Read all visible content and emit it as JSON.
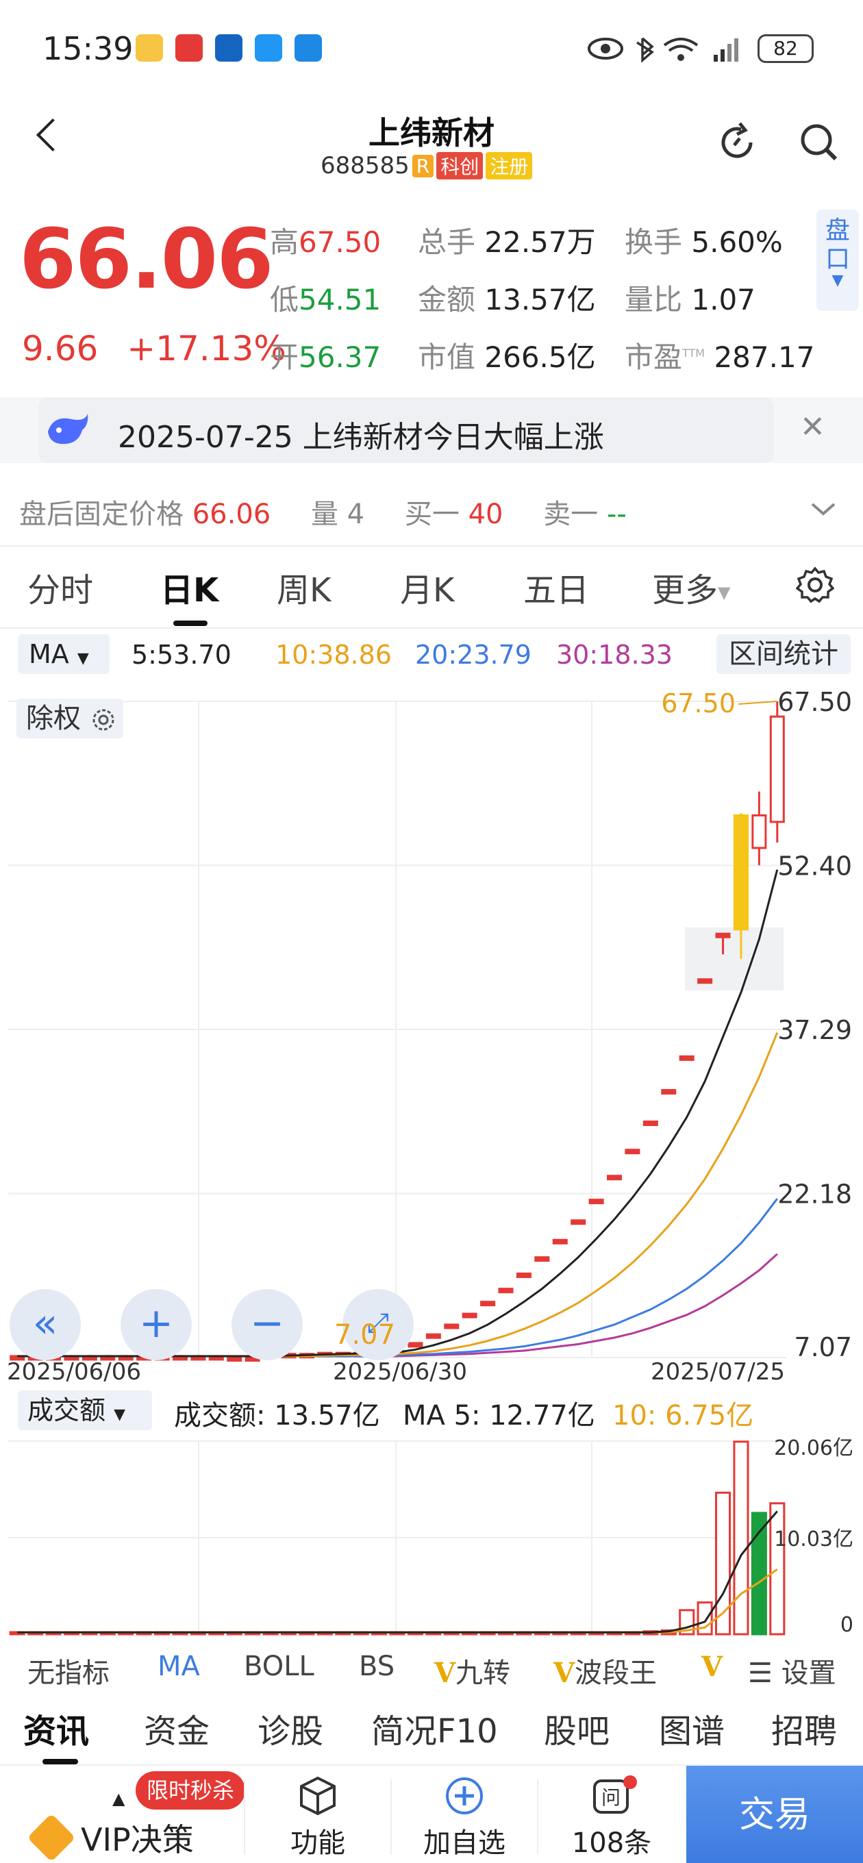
{
  "status_bar": {
    "time": "15:39",
    "battery": "82"
  },
  "header": {
    "title": "上纬新材",
    "code": "688585",
    "tag_r": "R",
    "tag_kechuang": "科创",
    "tag_zhuce": "注册"
  },
  "quote": {
    "price": "66.06",
    "change": "9.66",
    "change_pct": "+17.13%",
    "high_label": "高",
    "high": "67.50",
    "low_label": "低",
    "low": "54.51",
    "open_label": "开",
    "open": "56.37",
    "volume_label": "总手",
    "volume": "22.57万",
    "amount_label": "金额",
    "amount": "13.57亿",
    "mktcap_label": "市值",
    "mktcap": "266.5亿",
    "turnover_label": "换手",
    "turnover": "5.60%",
    "volratio_label": "量比",
    "volratio": "1.07",
    "pe_label": "市盈",
    "pe_sup": "TTM",
    "pe": "287.17",
    "pankou": "盘口"
  },
  "news": {
    "text": "2025-07-25 上纬新材今日大幅上涨"
  },
  "after_hours": {
    "label": "盘后固定价格",
    "price": "66.06",
    "vol_label": "量",
    "vol": "4",
    "buy1_label": "买一",
    "buy1": "40",
    "sell1_label": "卖一",
    "sell1": "--"
  },
  "tabs": [
    "分时",
    "日K",
    "周K",
    "月K",
    "五日",
    "更多"
  ],
  "ma_line": {
    "selector": "MA",
    "ma5": "5:53.70",
    "ma10": "10:38.86",
    "ma20": "20:23.79",
    "ma30": "30:18.33",
    "range_stats": "区间统计"
  },
  "chart_controls": {
    "chuquan": "除权"
  },
  "colors": {
    "up": "#e53935",
    "down": "#1b9e3e",
    "ma5": "#222222",
    "ma10": "#e8a21a",
    "ma20": "#3d7be0",
    "ma30": "#b43b9a",
    "accent": "#3d7be0"
  },
  "chart_data": [
    {
      "type": "candlestick",
      "y_ticks": [
        "67.50",
        "52.40",
        "37.29",
        "22.18",
        "7.07"
      ],
      "ylim": [
        7.07,
        67.5
      ],
      "x_tick_labels": [
        "2025/06/06",
        "2025/06/30",
        "2025/07/25"
      ],
      "max_label": "67.50",
      "min_label": "7.07",
      "candles": [
        {
          "o": 7.2,
          "h": 7.3,
          "l": 7.1,
          "c": 7.2
        },
        {
          "o": 7.2,
          "h": 7.3,
          "l": 7.1,
          "c": 7.2
        },
        {
          "o": 7.2,
          "h": 7.3,
          "l": 7.1,
          "c": 7.2
        },
        {
          "o": 7.2,
          "h": 7.3,
          "l": 7.1,
          "c": 7.2
        },
        {
          "o": 7.2,
          "h": 7.3,
          "l": 7.1,
          "c": 7.2
        },
        {
          "o": 7.2,
          "h": 7.3,
          "l": 7.1,
          "c": 7.2
        },
        {
          "o": 7.2,
          "h": 7.3,
          "l": 7.1,
          "c": 7.2
        },
        {
          "o": 7.2,
          "h": 7.3,
          "l": 7.1,
          "c": 7.2
        },
        {
          "o": 7.2,
          "h": 7.3,
          "l": 7.1,
          "c": 7.2
        },
        {
          "o": 7.2,
          "h": 7.3,
          "l": 7.1,
          "c": 7.2
        },
        {
          "o": 7.2,
          "h": 7.3,
          "l": 7.1,
          "c": 7.2
        },
        {
          "o": 7.2,
          "h": 7.3,
          "l": 7.1,
          "c": 7.2
        },
        {
          "o": 7.1,
          "h": 7.2,
          "l": 7.07,
          "c": 7.1
        },
        {
          "o": 7.1,
          "h": 7.2,
          "l": 7.07,
          "c": 7.1
        },
        {
          "o": 7.4,
          "h": 7.5,
          "l": 7.3,
          "c": 7.4
        },
        {
          "o": 7.4,
          "h": 7.5,
          "l": 7.3,
          "c": 7.4
        },
        {
          "o": 7.4,
          "h": 7.5,
          "l": 7.3,
          "c": 7.4
        },
        {
          "o": 7.5,
          "h": 7.5,
          "l": 7.4,
          "c": 7.5
        },
        {
          "o": 7.5,
          "h": 7.5,
          "l": 7.4,
          "c": 7.5
        },
        {
          "o": 7.5,
          "h": 7.5,
          "l": 7.4,
          "c": 7.5
        },
        {
          "o": 7.6,
          "h": 7.6,
          "l": 7.5,
          "c": 7.6
        },
        {
          "o": 7.6,
          "h": 7.6,
          "l": 7.5,
          "c": 7.6
        },
        {
          "o": 8.4,
          "h": 8.4,
          "l": 8.4,
          "c": 8.4
        },
        {
          "o": 9.2,
          "h": 9.2,
          "l": 9.2,
          "c": 9.2
        },
        {
          "o": 10.1,
          "h": 10.1,
          "l": 10.1,
          "c": 10.1
        },
        {
          "o": 11.1,
          "h": 11.1,
          "l": 11.1,
          "c": 11.1
        },
        {
          "o": 12.2,
          "h": 12.2,
          "l": 12.2,
          "c": 12.2
        },
        {
          "o": 13.4,
          "h": 13.4,
          "l": 13.4,
          "c": 13.4
        },
        {
          "o": 14.8,
          "h": 14.8,
          "l": 14.8,
          "c": 14.8
        },
        {
          "o": 16.3,
          "h": 16.3,
          "l": 16.3,
          "c": 16.3
        },
        {
          "o": 17.9,
          "h": 17.9,
          "l": 17.9,
          "c": 17.9
        },
        {
          "o": 19.7,
          "h": 19.7,
          "l": 19.7,
          "c": 19.7
        },
        {
          "o": 21.6,
          "h": 21.6,
          "l": 21.6,
          "c": 21.6
        },
        {
          "o": 23.8,
          "h": 23.8,
          "l": 23.8,
          "c": 23.8
        },
        {
          "o": 26.2,
          "h": 26.2,
          "l": 26.2,
          "c": 26.2
        },
        {
          "o": 28.8,
          "h": 28.8,
          "l": 28.8,
          "c": 28.8
        },
        {
          "o": 31.7,
          "h": 31.7,
          "l": 31.7,
          "c": 31.7
        },
        {
          "o": 34.8,
          "h": 34.8,
          "l": 34.8,
          "c": 34.8
        },
        {
          "o": 41.9,
          "h": 41.9,
          "l": 41.9,
          "c": 41.9
        },
        {
          "o": 46.0,
          "h": 46.1,
          "l": 44.2,
          "c": 46.1
        },
        {
          "o": 57.0,
          "h": 57.2,
          "l": 43.8,
          "c": 46.5
        },
        {
          "o": 54.0,
          "h": 59.2,
          "l": 52.4,
          "c": 57.0
        },
        {
          "o": 56.4,
          "h": 67.5,
          "l": 54.5,
          "c": 66.1
        }
      ],
      "ma5": [
        7.2,
        7.2,
        7.2,
        7.2,
        7.2,
        7.2,
        7.2,
        7.2,
        7.2,
        7.2,
        7.2,
        7.2,
        7.2,
        7.2,
        7.2,
        7.25,
        7.3,
        7.35,
        7.4,
        7.45,
        7.5,
        7.55,
        7.8,
        8.2,
        8.7,
        9.3,
        10.1,
        11.1,
        12.2,
        13.4,
        14.8,
        16.3,
        18.0,
        19.8,
        21.8,
        24.0,
        26.5,
        29.2,
        32.5,
        36.6,
        40.7,
        45.6,
        52.0
      ],
      "ma10": [
        7.2,
        7.2,
        7.2,
        7.2,
        7.2,
        7.2,
        7.2,
        7.2,
        7.2,
        7.2,
        7.2,
        7.2,
        7.2,
        7.2,
        7.2,
        7.2,
        7.2,
        7.25,
        7.3,
        7.3,
        7.35,
        7.4,
        7.5,
        7.65,
        7.9,
        8.2,
        8.6,
        9.1,
        9.7,
        10.4,
        11.2,
        12.1,
        13.2,
        14.4,
        15.8,
        17.4,
        19.2,
        21.2,
        23.5,
        26.3,
        29.4,
        32.9,
        37.0
      ],
      "ma20": [
        7.2,
        7.2,
        7.2,
        7.2,
        7.2,
        7.2,
        7.2,
        7.2,
        7.2,
        7.2,
        7.2,
        7.2,
        7.2,
        7.2,
        7.2,
        7.2,
        7.2,
        7.2,
        7.2,
        7.2,
        7.25,
        7.3,
        7.35,
        7.4,
        7.5,
        7.6,
        7.75,
        7.9,
        8.1,
        8.4,
        8.7,
        9.1,
        9.6,
        10.1,
        10.8,
        11.5,
        12.4,
        13.4,
        14.6,
        16.0,
        17.6,
        19.5,
        21.7
      ],
      "ma30": [
        7.2,
        7.2,
        7.2,
        7.2,
        7.2,
        7.2,
        7.2,
        7.2,
        7.2,
        7.2,
        7.2,
        7.2,
        7.2,
        7.2,
        7.2,
        7.2,
        7.2,
        7.2,
        7.2,
        7.2,
        7.2,
        7.2,
        7.25,
        7.3,
        7.35,
        7.4,
        7.5,
        7.6,
        7.7,
        7.9,
        8.1,
        8.3,
        8.6,
        8.9,
        9.3,
        9.8,
        10.4,
        11.0,
        11.8,
        12.8,
        13.9,
        15.1,
        16.6
      ]
    },
    {
      "type": "bar",
      "y_ticks": [
        "20.06亿",
        "10.03亿",
        "0"
      ],
      "ylim": [
        0,
        20.06
      ],
      "values": [
        0.2,
        0.2,
        0.2,
        0.2,
        0.2,
        0.2,
        0.2,
        0.2,
        0.2,
        0.2,
        0.2,
        0.2,
        0.2,
        0.2,
        0.2,
        0.2,
        0.2,
        0.2,
        0.2,
        0.2,
        0.2,
        0.2,
        0.1,
        0.1,
        0.1,
        0.1,
        0.1,
        0.1,
        0.1,
        0.1,
        0.1,
        0.1,
        0.2,
        0.2,
        0.2,
        0.3,
        0.4,
        2.5,
        3.3,
        14.7,
        20.0,
        12.6,
        13.6
      ],
      "ma5": [
        0.2,
        0.2,
        0.2,
        0.2,
        0.2,
        0.2,
        0.2,
        0.2,
        0.2,
        0.2,
        0.2,
        0.2,
        0.2,
        0.2,
        0.2,
        0.2,
        0.2,
        0.2,
        0.2,
        0.2,
        0.2,
        0.2,
        0.2,
        0.2,
        0.2,
        0.2,
        0.2,
        0.2,
        0.2,
        0.2,
        0.2,
        0.2,
        0.2,
        0.2,
        0.2,
        0.2,
        0.3,
        0.7,
        1.3,
        4.2,
        8.2,
        10.6,
        12.77
      ],
      "ma10": [
        0.2,
        0.2,
        0.2,
        0.2,
        0.2,
        0.2,
        0.2,
        0.2,
        0.2,
        0.2,
        0.2,
        0.2,
        0.2,
        0.2,
        0.2,
        0.2,
        0.2,
        0.2,
        0.2,
        0.2,
        0.2,
        0.2,
        0.2,
        0.2,
        0.2,
        0.2,
        0.2,
        0.2,
        0.2,
        0.2,
        0.2,
        0.2,
        0.2,
        0.2,
        0.2,
        0.2,
        0.2,
        0.4,
        0.7,
        2.2,
        4.2,
        5.4,
        6.75
      ]
    }
  ],
  "price_chart_labels": {
    "min_marker": "7.07"
  },
  "volume": {
    "selector": "成交额",
    "amount_label": "成交额:",
    "amount": "13.57亿",
    "ma5_label": "MA 5:",
    "ma5": "12.77亿",
    "ma10_label": "10:",
    "ma10": "6.75亿"
  },
  "indicators": [
    "无指标",
    "MA",
    "BOLL",
    "BS",
    "九转",
    "波段王",
    "设置"
  ],
  "indicator_v": "V",
  "bottom_tabs": [
    "资讯",
    "资金",
    "诊股",
    "简况F10",
    "股吧",
    "图谱",
    "招聘"
  ],
  "bottom_bar": {
    "vip": "VIP决策",
    "flash_sale": "限时秒杀",
    "function": "功能",
    "add_watch": "加自选",
    "ask_count": "108条",
    "trade": "交易"
  }
}
